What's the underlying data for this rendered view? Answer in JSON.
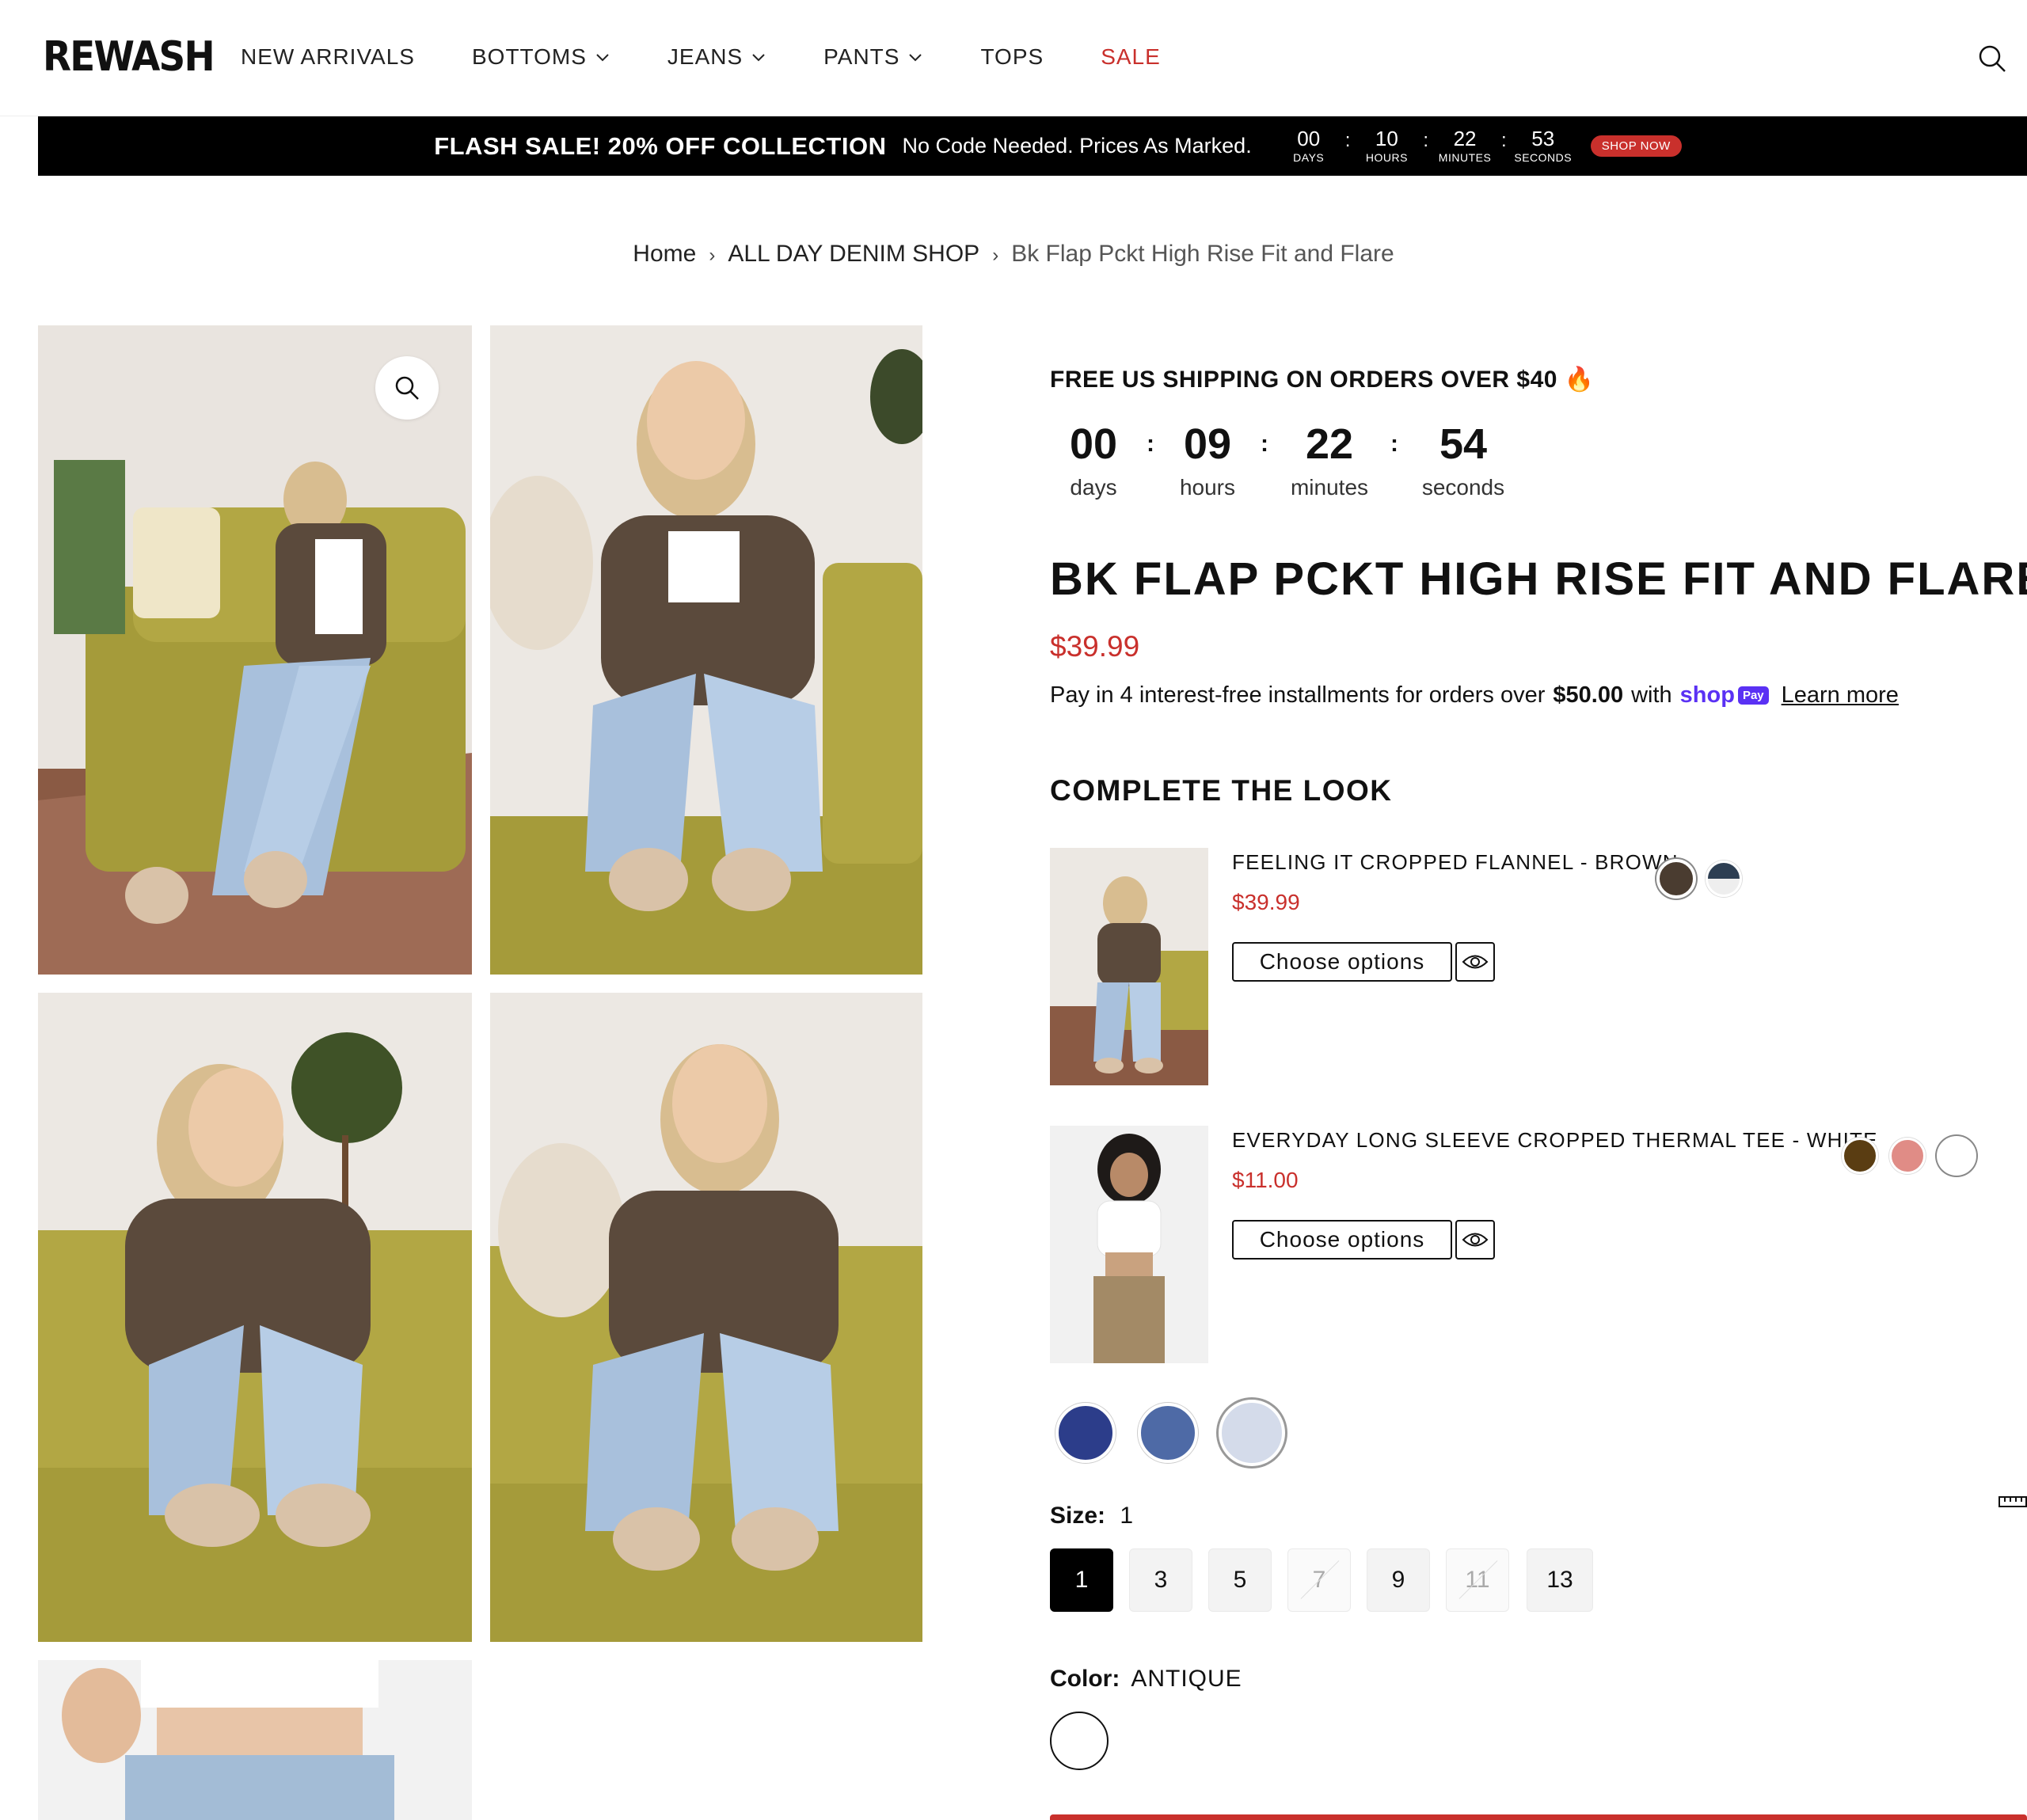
{
  "header": {
    "logo": "REWASH",
    "nav": [
      {
        "label": "NEW ARRIVALS",
        "dropdown": false
      },
      {
        "label": "BOTTOMS",
        "dropdown": true
      },
      {
        "label": "JEANS",
        "dropdown": true
      },
      {
        "label": "PANTS",
        "dropdown": true
      },
      {
        "label": "TOPS",
        "dropdown": false
      },
      {
        "label": "SALE",
        "dropdown": false,
        "color": "#c9302c"
      }
    ],
    "search_icon": "search-icon"
  },
  "flash_bar": {
    "title": "FLASH SALE! 20% OFF COLLECTION",
    "subtitle": "No Code Needed. Prices As Marked.",
    "countdown": [
      {
        "value": "00",
        "label": "DAYS"
      },
      {
        "value": "10",
        "label": "HOURS"
      },
      {
        "value": "22",
        "label": "MINUTES"
      },
      {
        "value": "53",
        "label": "SECONDS"
      }
    ],
    "button": "SHOP NOW"
  },
  "breadcrumb": {
    "items": [
      "Home",
      "ALL DAY DENIM SHOP"
    ],
    "current": "Bk Flap Pckt High Rise Fit and Flare"
  },
  "product": {
    "shipping_notice": "FREE US SHIPPING ON ORDERS OVER $40",
    "shipping_emoji": "🔥",
    "countdown": [
      {
        "value": "00",
        "label": "days"
      },
      {
        "value": "09",
        "label": "hours"
      },
      {
        "value": "22",
        "label": "minutes"
      },
      {
        "value": "54",
        "label": "seconds"
      }
    ],
    "title": "BK FLAP PCKT HIGH RISE FIT AND FLARE",
    "price": "$39.99",
    "installments": {
      "text": "Pay in 4 interest-free installments for orders over",
      "amount": "$50.00",
      "with": "with",
      "brand": "shop",
      "brand_badge": "Pay",
      "link": "Learn more"
    },
    "complete_the_look": {
      "title": "COMPLETE THE LOOK",
      "items": [
        {
          "name": "FEELING IT CROPPED FLANNEL - BROWN",
          "price": "$39.99",
          "button": "Choose options",
          "swatches": [
            "#4a3c30",
            "#2d3e52"
          ]
        },
        {
          "name": "EVERYDAY LONG SLEEVE CROPPED THERMAL TEE - WHITE",
          "price": "$11.00",
          "button": "Choose options",
          "swatches": [
            "#5a3d12",
            "#e08c86",
            "#ffffff"
          ]
        }
      ]
    },
    "wash_swatches": [
      "#2c3d8a",
      "#4e6aa6",
      "#d4dbea"
    ],
    "size": {
      "label": "Size:",
      "selected": "1",
      "options": [
        {
          "value": "1",
          "state": "active"
        },
        {
          "value": "3",
          "state": "available"
        },
        {
          "value": "5",
          "state": "available"
        },
        {
          "value": "7",
          "state": "disabled"
        },
        {
          "value": "9",
          "state": "available"
        },
        {
          "value": "11",
          "state": "disabled"
        },
        {
          "value": "13",
          "state": "available"
        }
      ]
    },
    "color": {
      "label": "Color:",
      "selected": "ANTIQUE"
    }
  },
  "colors": {
    "accent": "#c9302c",
    "shop_pay": "#5a31f4"
  }
}
